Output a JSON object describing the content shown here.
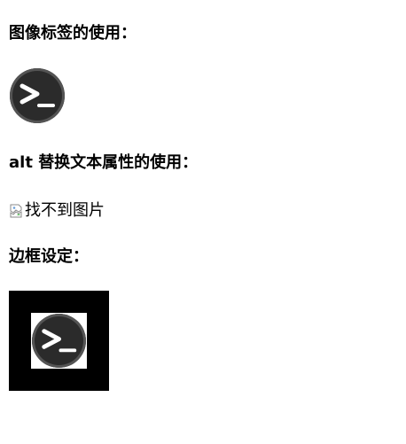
{
  "sections": {
    "image_tag_heading": "图像标签的使用：",
    "alt_heading": "alt 替换文本属性的使用：",
    "border_heading": "边框设定："
  },
  "images": {
    "terminal_icon": "terminal-icon",
    "broken_image_icon": "broken-image-icon",
    "alt_text": "找不到图片"
  },
  "colors": {
    "icon_background": "#2b2b2b",
    "icon_ring": "#545454",
    "border": "#000000"
  }
}
